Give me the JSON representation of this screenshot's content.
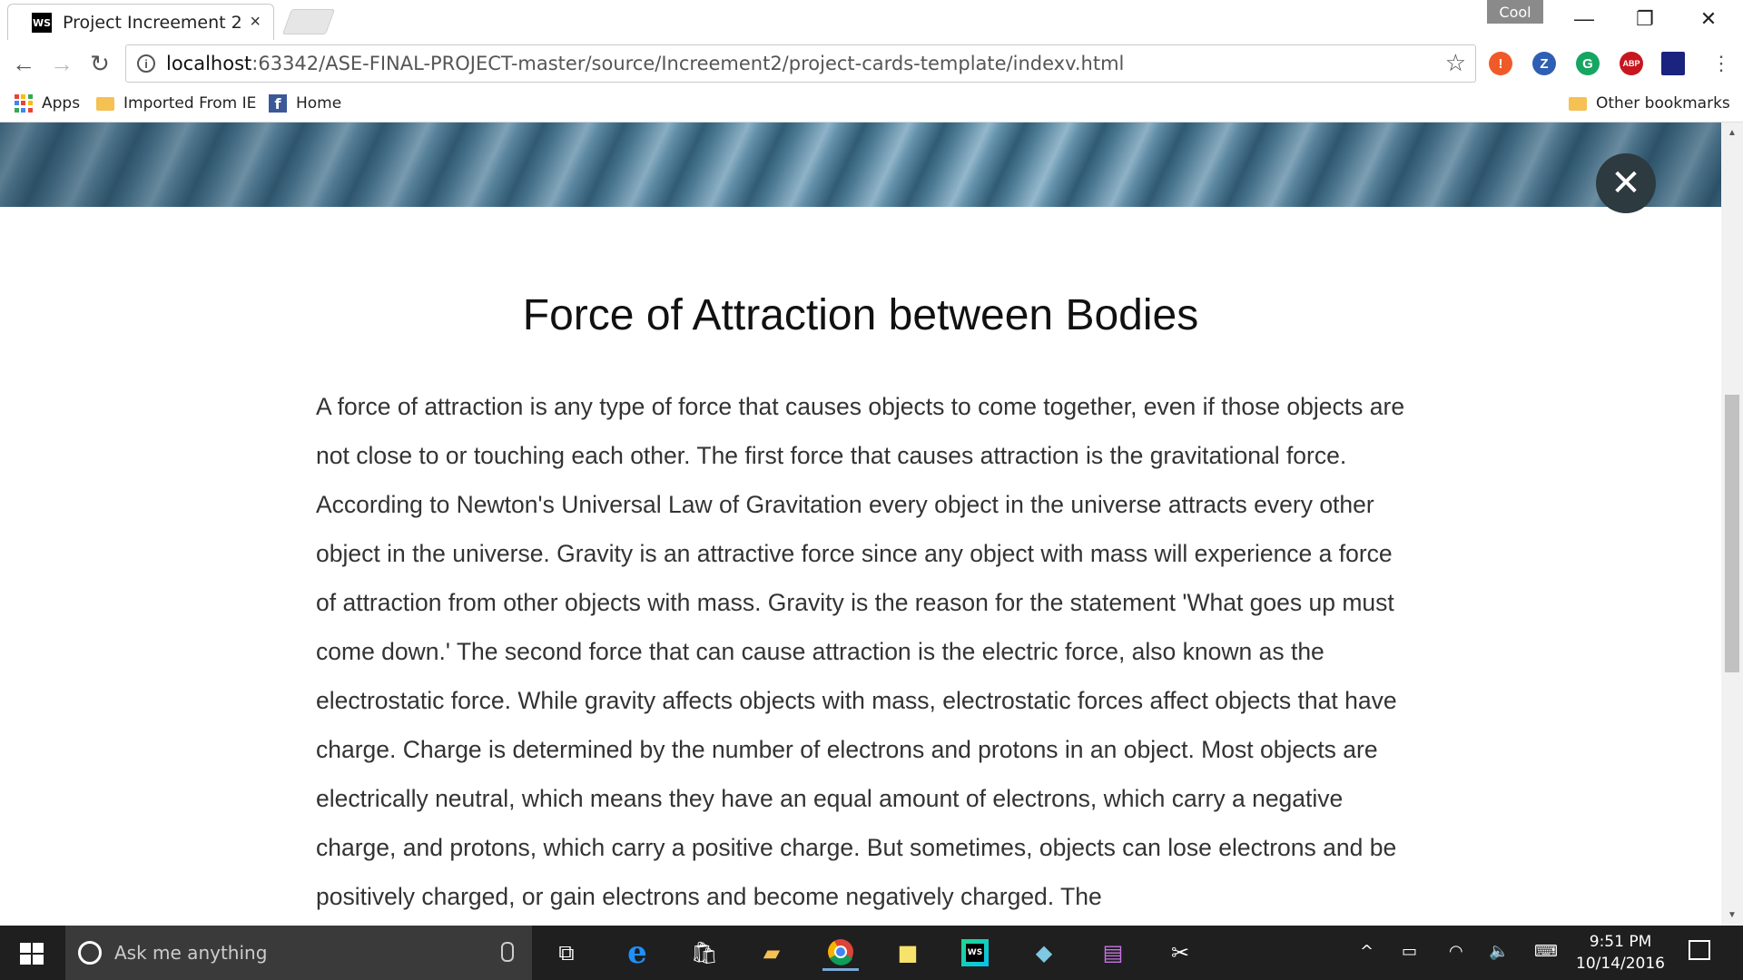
{
  "browser": {
    "tab_title": "Project Increement 2",
    "tab_favicon": "WS",
    "tab_close": "×",
    "profile_badge": "Cool",
    "url_host": "localhost",
    "url_rest": ":63342/ASE-FINAL-PROJECT-master/source/Increement2/project-cards-template/indexv.html",
    "bookmarks": {
      "apps": "Apps",
      "imported": "Imported From IE",
      "home": "Home",
      "other": "Other bookmarks"
    },
    "extensions": [
      {
        "name": "alert-extension-icon",
        "glyph": "!",
        "color": "#f05a28"
      },
      {
        "name": "zotero-extension-icon",
        "glyph": "Z",
        "color": "#2f5fb3"
      },
      {
        "name": "grammarly-extension-icon",
        "glyph": "G",
        "color": "#15a662"
      },
      {
        "name": "adblock-extension-icon",
        "glyph": "ABP",
        "color": "#c7161d"
      }
    ]
  },
  "page": {
    "title": "Force of Attraction between Bodies",
    "body": "A force of attraction is any type of force that causes objects to come together, even if those objects are not close to or touching each other. The first force that causes attraction is the gravitational force. According to Newton's Universal Law of Gravitation every object in the universe attracts every other object in the universe. Gravity is an attractive force since any object with mass will experience a force of attraction from other objects with mass. Gravity is the reason for the statement 'What goes up must come down.' The second force that can cause attraction is the electric force, also known as the electrostatic force. While gravity affects objects with mass, electrostatic forces affect objects that have charge. Charge is determined by the number of electrons and protons in an object. Most objects are electrically neutral, which means they have an equal amount of electrons, which carry a negative charge, and protons, which carry a positive charge. But sometimes, objects can lose electrons and be positively charged, or gain electrons and become negatively charged. The"
  },
  "taskbar": {
    "search_placeholder": "Ask me anything",
    "time": "9:51 PM",
    "date": "10/14/2016"
  }
}
